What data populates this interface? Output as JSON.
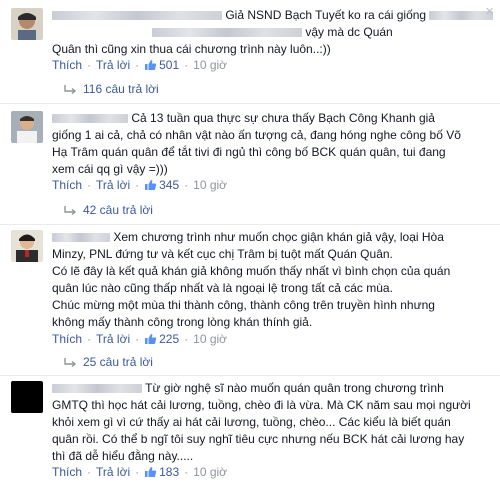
{
  "comments": [
    {
      "line1": "Giả NSND Bạch Tuyết ko ra cái giống",
      "line1b": "vậy mà dc Quán",
      "line2": "Quân thì cũng xin thua cái chương trình này luôn..:))",
      "like_label": "Thích",
      "reply_label": "Trả lời",
      "likes": "501",
      "time": "10 giờ",
      "replies_label": "116 câu trả lời"
    },
    {
      "line1": "Cả 13 tuần qua thực sự chưa thấy Bạch Công Khanh giả",
      "line2": "giống 1 ai cả, chả có nhân vật nào ấn tượng cả, đang hóng nghe công bố Võ",
      "line3": "Hạ Trâm quán quân để tắt tivi đi ngủ thì công bố BCK quán quân, tui đang",
      "line4": "xem cái qq gì vậy =)))",
      "like_label": "Thích",
      "reply_label": "Trả lời",
      "likes": "345",
      "time": "10 giờ",
      "replies_label": "42 câu trả lời"
    },
    {
      "line1": "Xem chương trình như muốn chọc giận khán giả vậy, loại Hòa",
      "line2": "Minzy, PNL đứng tư và kết cục chị Trâm bị tuột mất Quán Quân.",
      "line3": "Có lẽ đây là kết quả khán giả không muốn thấy nhất vì bình chọn của quán",
      "line4": "quân lúc nào cũng thấp nhất và là ngoại lệ trong tất cả các mùa.",
      "line5": "Chúc mừng một mùa thi thành công, thành công trên truyền hình nhưng",
      "line6": "không mấy thành công trong lòng khán thính giả.",
      "like_label": "Thích",
      "reply_label": "Trả lời",
      "likes": "225",
      "time": "10 giờ",
      "replies_label": "25 câu trả lời"
    },
    {
      "line1": "Từ giờ nghệ sĩ nào muốn quán quân trong chương trình",
      "line2": "GMTQ thì học hát cải lương, tuồng, chèo đi là vừa. Mà CK năm sau mọi người",
      "line3": "khỏi xem gì vì cứ thấy ai hát cải lương, tuồng, chèo... Các kiểu là biết quán",
      "line4": "quân rồi. Có thể b ngĩ tôi suy nghĩ tiêu cực nhưng nếu BCK hát cải lương hay",
      "line5": "thì đã dễ hiểu đằng này.....",
      "like_label": "Thích",
      "reply_label": "Trả lời",
      "likes": "183",
      "time": "10 giờ"
    }
  ],
  "colors": {
    "link": "#3b5998",
    "meta": "#90949c",
    "text": "#141823",
    "divider": "#e9ebee"
  },
  "icons": [
    "thumbs-up-icon",
    "reply-arrow-icon",
    "close-icon"
  ]
}
